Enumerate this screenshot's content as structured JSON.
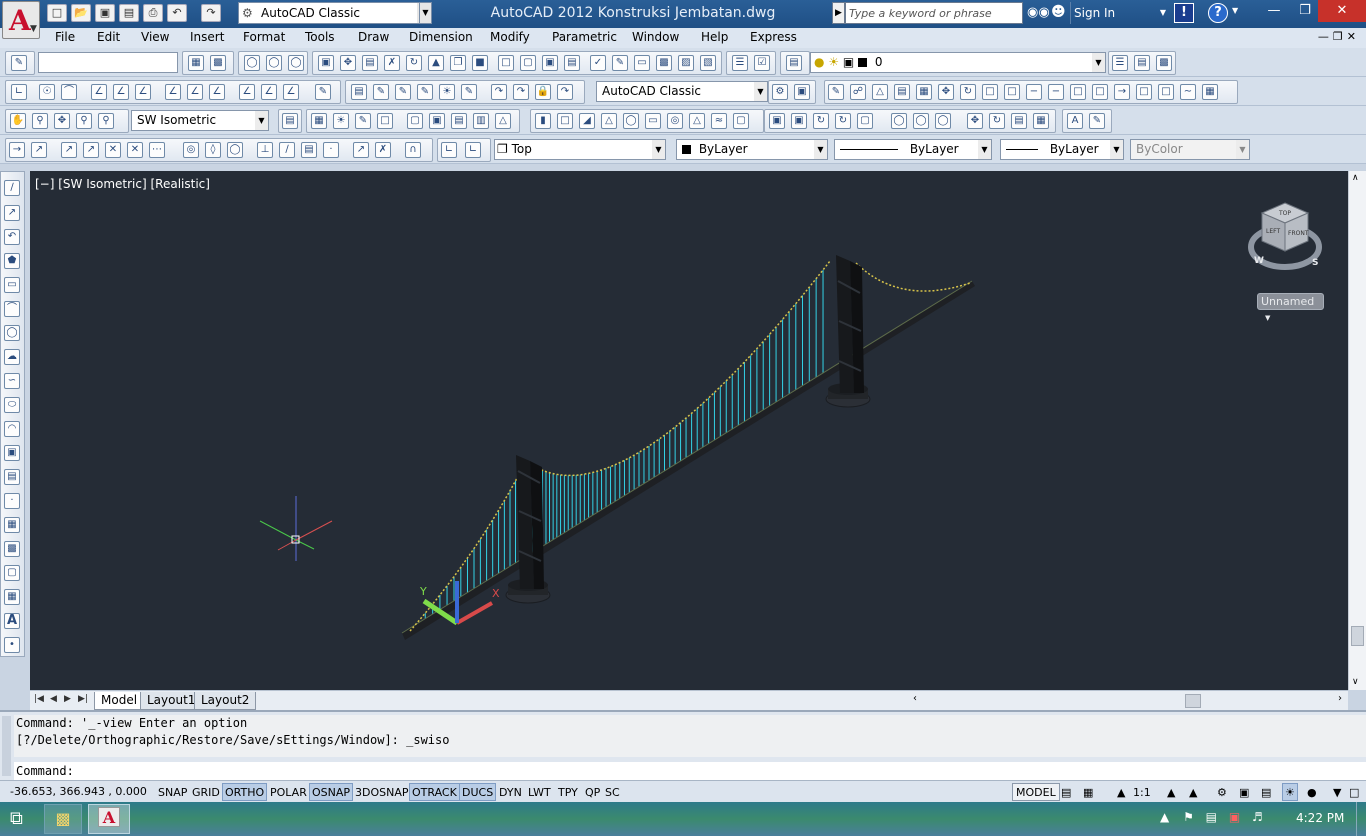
{
  "window": {
    "title": "AutoCAD 2012    Konstruksi Jembatan.dwg",
    "workspace": "AutoCAD Classic",
    "search_placeholder": "Type a keyword or phrase",
    "sign_in": "Sign In"
  },
  "menu": [
    "File",
    "Edit",
    "View",
    "Insert",
    "Format",
    "Tools",
    "Draw",
    "Dimension",
    "Modify",
    "Parametric",
    "Window",
    "Help",
    "Express"
  ],
  "toolbars": {
    "layer_name": "0",
    "workspace_combo": "AutoCAD Classic",
    "view_combo": "SW Isometric",
    "ucs_combo": "Top",
    "color_combo": "ByLayer",
    "linetype_combo": "ByLayer",
    "lineweight_combo": "ByLayer",
    "plotstyle_combo": "ByColor"
  },
  "viewport": {
    "label": "[−] [SW Isometric] [Realistic]",
    "named_view": "Unnamed",
    "viewcube": {
      "top": "TOP",
      "left": "LEFT",
      "front": "FRONT",
      "west": "W",
      "south": "S"
    },
    "ucs": {
      "x": "X",
      "y": "Y"
    },
    "background": "#252c36",
    "bridge_deck_color": "#1e2024",
    "hanger_color": "#33d2e6",
    "cable_color": "#d6c24a"
  },
  "layout_tabs": [
    "Model",
    "Layout1",
    "Layout2"
  ],
  "command": {
    "history": [
      "Command: '_-view Enter an option",
      "[?/Delete/Orthographic/Restore/Save/sEttings/Window]: _swiso"
    ],
    "prompt": "Command:"
  },
  "status": {
    "coords": "-36.653,  366.943 , 0.000",
    "buttons": [
      "SNAP",
      "GRID",
      "ORTHO",
      "POLAR",
      "OSNAP",
      "3DOSNAP",
      "OTRACK",
      "DUCS",
      "DYN",
      "LWT",
      "TPY",
      "QP",
      "SC"
    ],
    "active": [
      "ORTHO",
      "OSNAP",
      "OTRACK",
      "DUCS"
    ],
    "space": "MODEL",
    "annotation_scale": "1:1"
  },
  "taskbar": {
    "clock": "4:22 PM"
  }
}
